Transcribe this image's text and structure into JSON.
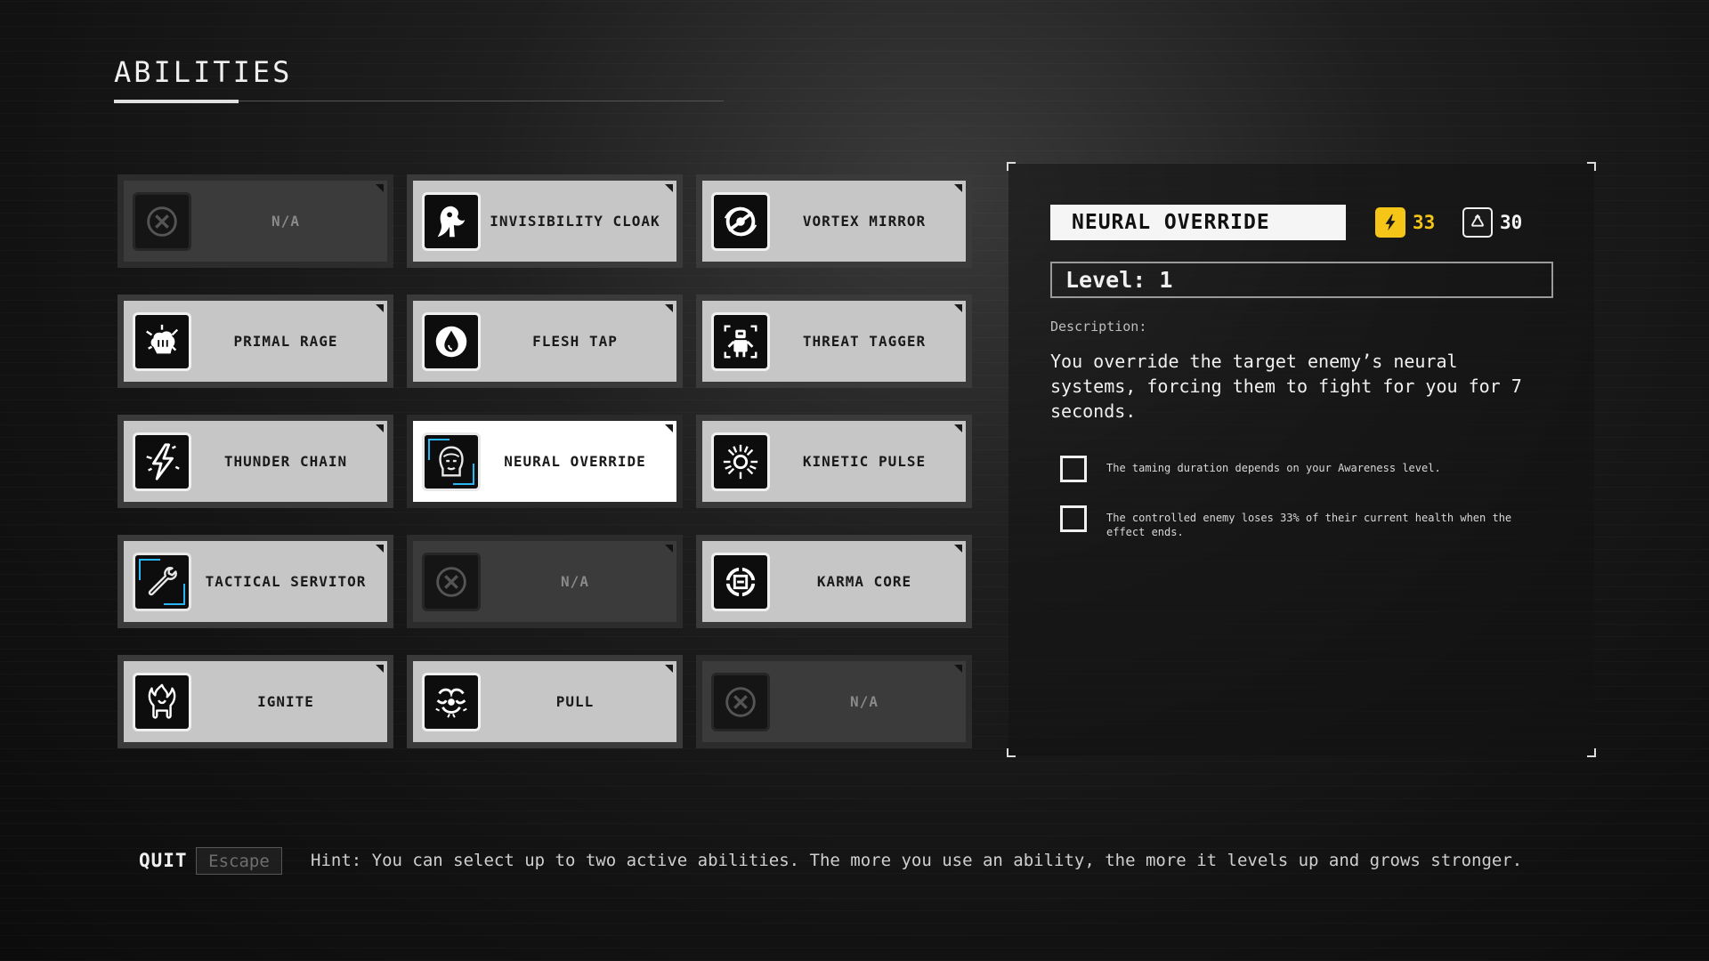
{
  "screen": {
    "title": "ABILITIES"
  },
  "abilities": [
    {
      "label": "N/A",
      "icon": "empty-slot-icon",
      "state": "empty"
    },
    {
      "label": "INVISIBILITY CLOAK",
      "icon": "cloak-icon",
      "state": "available"
    },
    {
      "label": "VORTEX MIRROR",
      "icon": "vortex-icon",
      "state": "available"
    },
    {
      "label": "PRIMAL RAGE",
      "icon": "fist-icon",
      "state": "available"
    },
    {
      "label": "FLESH TAP",
      "icon": "blood-drop-icon",
      "state": "available"
    },
    {
      "label": "THREAT TAGGER",
      "icon": "target-robot-icon",
      "state": "available"
    },
    {
      "label": "THUNDER CHAIN",
      "icon": "lightning-icon",
      "state": "available"
    },
    {
      "label": "NEURAL OVERRIDE",
      "icon": "head-icon",
      "state": "selected"
    },
    {
      "label": "KINETIC PULSE",
      "icon": "sunburst-icon",
      "state": "available"
    },
    {
      "label": "TACTICAL SERVITOR",
      "icon": "wrench-icon",
      "state": "available"
    },
    {
      "label": "N/A",
      "icon": "empty-slot-icon",
      "state": "empty"
    },
    {
      "label": "KARMA CORE",
      "icon": "core-icon",
      "state": "available"
    },
    {
      "label": "IGNITE",
      "icon": "flame-hand-icon",
      "state": "available"
    },
    {
      "label": "PULL",
      "icon": "grab-icon",
      "state": "available"
    },
    {
      "label": "N/A",
      "icon": "empty-slot-icon",
      "state": "empty"
    }
  ],
  "detail": {
    "name": "NEURAL OVERRIDE",
    "energy_cost": "33",
    "cooldown": "30",
    "level": "Level: 1",
    "description_label": "Description:",
    "description": "You override the target enemy’s neural systems, forcing them to fight for you for 7 seconds.",
    "traits": [
      "The taming duration depends on your Awareness level.",
      "The controlled enemy loses 33% of their current health when the effect ends."
    ],
    "colors": {
      "energy": "#f5c518",
      "accent": "#29b6f6"
    }
  },
  "footer": {
    "quit_label": "QUIT",
    "quit_key": "Escape",
    "hint": "Hint: You can select up to two active abilities. The more you use an ability, the more it levels up and grows stronger."
  }
}
